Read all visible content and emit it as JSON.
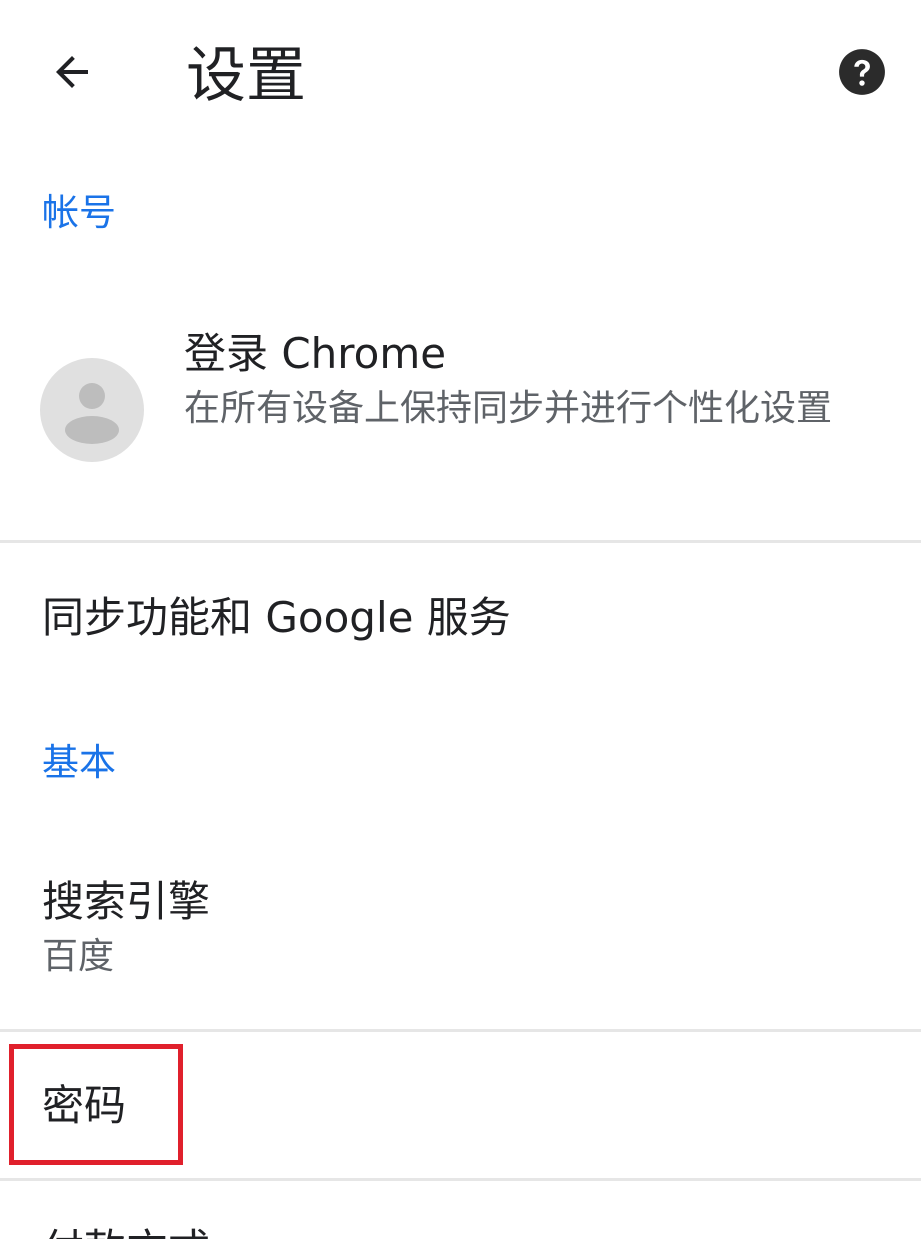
{
  "app_bar": {
    "back_icon": "arrow-left-icon",
    "title": "设置",
    "help_icon": "help-circle-icon"
  },
  "sections": {
    "account_header": "帐号",
    "basic_header": "基本"
  },
  "account": {
    "avatar_icon": "person-avatar-icon",
    "title": "登录 Chrome",
    "subtitle": "在所有设备上保持同步并进行个性化设置"
  },
  "sync": {
    "label": "同步功能和 Google 服务"
  },
  "search_engine": {
    "label": "搜索引擎",
    "value": "百度"
  },
  "passwords": {
    "label": "密码",
    "highlight_color": "#e0202c"
  },
  "next_item": {
    "label": "付款方式"
  },
  "colors": {
    "accent": "#1a73e8",
    "text_primary": "#202124",
    "text_secondary": "#5f6368"
  }
}
